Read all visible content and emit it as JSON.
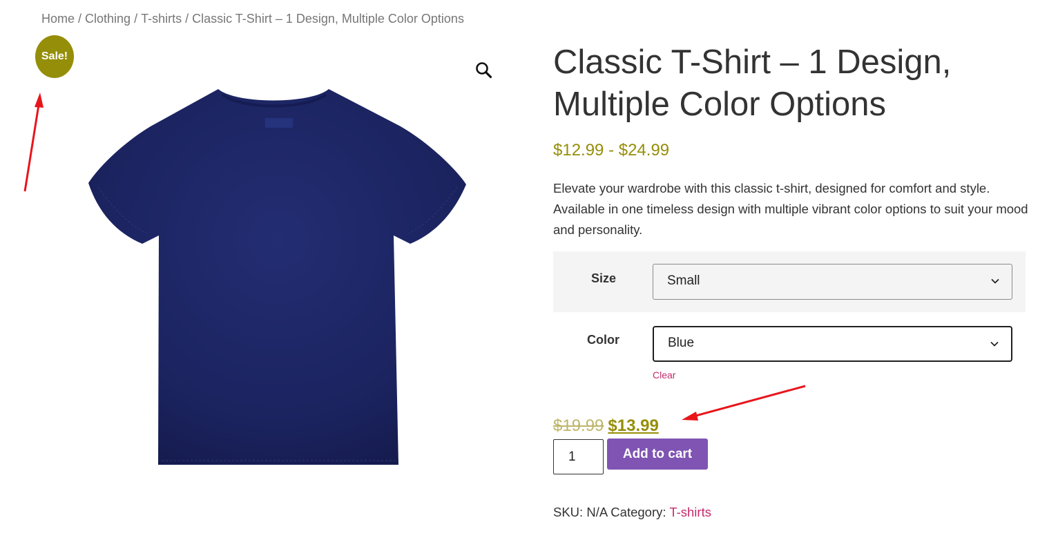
{
  "breadcrumb": {
    "home": "Home",
    "clothing": "Clothing",
    "tshirts": "T-shirts",
    "current": "Classic T-Shirt – 1 Design, Multiple Color Options",
    "separator": "/"
  },
  "gallery": {
    "sale_badge": "Sale!",
    "main_image_color": "#1c2563",
    "thumbnail_colors": [
      "#ffffff",
      "#1c2563",
      "#ffb27a",
      "#86c886"
    ]
  },
  "product": {
    "title": "Classic T-Shirt – 1 Design, Multiple Color Options",
    "price_range": "$12.99 - $24.99",
    "description": "Elevate your wardrobe with this classic t-shirt, designed for comfort and style. Available in one timeless design with multiple vibrant color options to suit your mood and personality."
  },
  "variations": {
    "size_label": "Size",
    "size_value": "Small",
    "color_label": "Color",
    "color_value": "Blue",
    "clear_label": "Clear"
  },
  "pricing": {
    "old_price": "$19.99",
    "new_price": "$13.99"
  },
  "cart": {
    "quantity": "1",
    "add_to_cart_label": "Add to cart"
  },
  "meta": {
    "sku_label": "SKU:",
    "sku_value": "N/A",
    "category_label": "Category:",
    "category_value": "T-shirts"
  },
  "colors": {
    "accent_price": "#958e09",
    "button": "#7f54b3",
    "link": "#c22b6a",
    "annotation_arrow": "#e8151b"
  }
}
